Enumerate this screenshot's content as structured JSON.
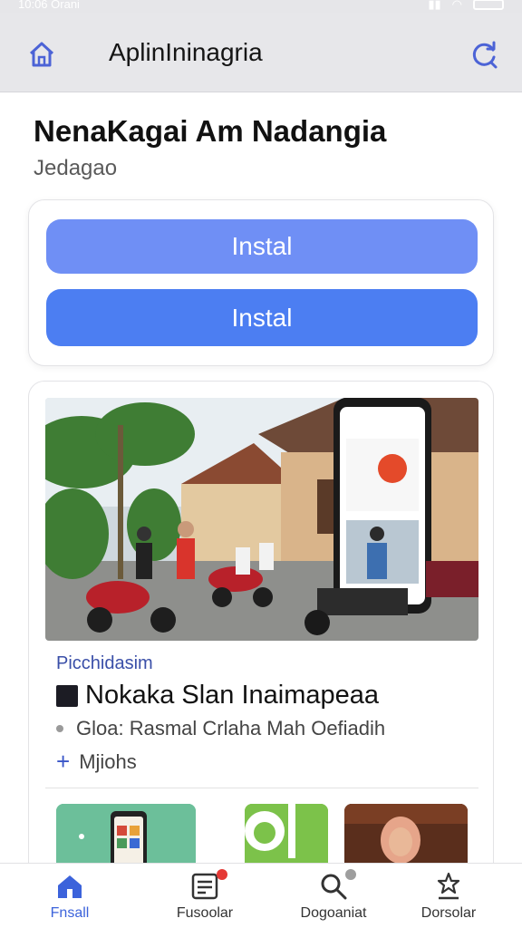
{
  "status_bar": {
    "time": "10:06 Orani"
  },
  "app_bar": {
    "title": "AplinIninagria",
    "home_icon": "home-icon",
    "refresh_icon": "refresh-icon"
  },
  "page": {
    "title": "NenaKagai Am Nadangia",
    "subtitle": "Jedagao"
  },
  "install": {
    "button_1": "Instal",
    "button_2": "Instal"
  },
  "feature": {
    "image_icon": "street-scene-with-phone-image",
    "kicker": "Picchidasim",
    "headline": "Nokaka Slan Inaimapeaa",
    "meta": "Gloa: Rasmal Crlaha Mah Oefiadih",
    "more": "Mjiohs"
  },
  "thumbnails": [
    "phone-app-thumbnail",
    "green-logo-thumbnail",
    "person-portrait-thumbnail"
  ],
  "bottom_nav": {
    "items": [
      {
        "label": "Fnsall",
        "icon": "home-icon",
        "active": true
      },
      {
        "label": "Fusoolar",
        "icon": "news-icon",
        "badge_color": "#e53935"
      },
      {
        "label": "Dogoaniat",
        "icon": "search-icon",
        "badge_color": "#9e9e9e"
      },
      {
        "label": "Dorsolar",
        "icon": "user-star-icon"
      }
    ]
  },
  "colors": {
    "accent": "#4c7ef2",
    "accent_light": "#6f8ff5",
    "app_bar": "#e7e7ea",
    "active_nav": "#3c63db"
  }
}
